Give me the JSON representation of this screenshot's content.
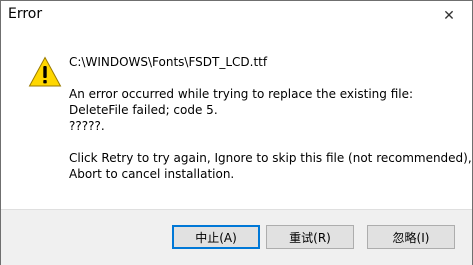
{
  "window": {
    "title": "Error",
    "close_glyph": "✕"
  },
  "message": {
    "icon": "warning-icon",
    "path": "C:\\WINDOWS\\Fonts\\FSDT_LCD.ttf",
    "line1": "An error occurred while trying to replace the existing file:",
    "line2": "DeleteFile failed; code 5.",
    "line3": "?????.",
    "line4": "Click Retry to try again, Ignore to skip this file (not recommended), or",
    "line5": "Abort to cancel installation."
  },
  "buttons": {
    "abort_label": "中止(A)",
    "retry_label": "重试(R)",
    "ignore_label": "忽略(I)"
  },
  "colors": {
    "warning_yellow": "#ffd700",
    "focus_border": "#0078d7",
    "footer_bg": "#f0f0f0"
  }
}
